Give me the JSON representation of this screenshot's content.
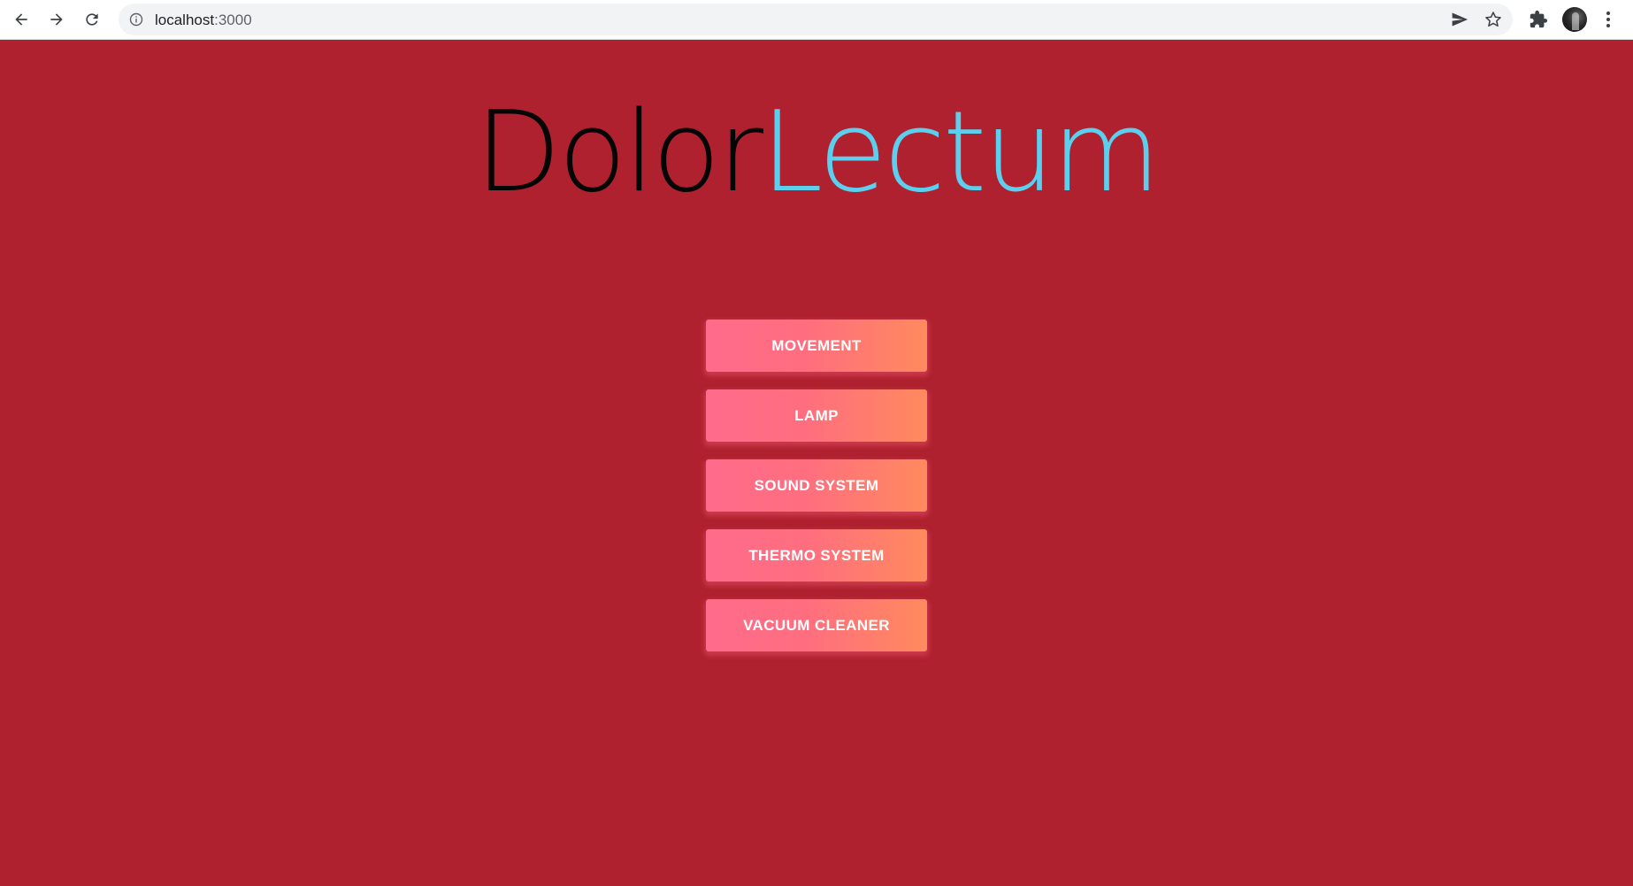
{
  "browser": {
    "url_host": "localhost",
    "url_port": ":3000",
    "icons": {
      "back": "arrow-left-icon",
      "forward": "arrow-right-icon",
      "reload": "reload-icon",
      "site_info": "info-icon",
      "send": "send-icon",
      "bookmark": "star-icon",
      "extensions": "puzzle-icon",
      "profile": "avatar",
      "menu": "kebab-menu-icon"
    }
  },
  "page": {
    "background_color": "#af212e",
    "title": {
      "part1": "Dolor",
      "part2": "Lectum",
      "part1_color": "#050505",
      "part2_color": "#5ccfef"
    },
    "menu": {
      "buttons": [
        {
          "label": "Movement"
        },
        {
          "label": "Lamp"
        },
        {
          "label": "Sound System"
        },
        {
          "label": "Thermo System"
        },
        {
          "label": "Vacuum Cleaner"
        }
      ],
      "button_gradient": [
        "#ff6b8b",
        "#ff8a5e"
      ],
      "button_text_color": "#ffffff"
    }
  }
}
